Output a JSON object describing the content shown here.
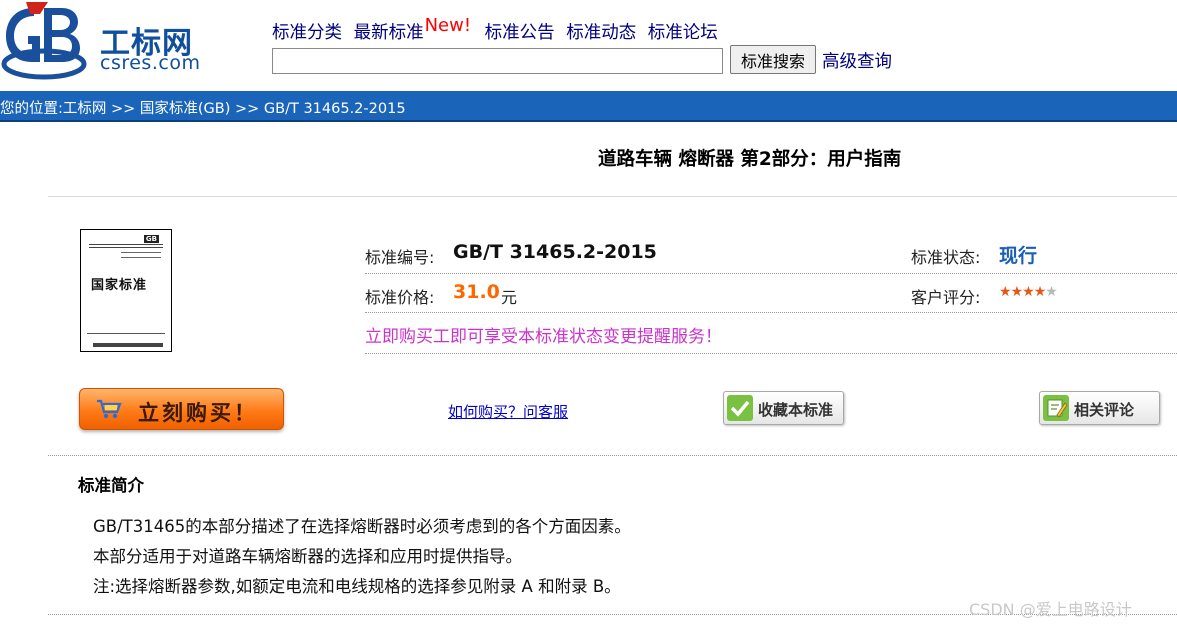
{
  "logo": {
    "mark": "GB",
    "name_cn": "工标网",
    "name_en": "csres.com"
  },
  "topnav": {
    "items": [
      "标准分类",
      "最新标准",
      "标准公告",
      "标准动态",
      "标准论坛"
    ],
    "new_badge": "New!"
  },
  "search": {
    "value": "",
    "button_label": "标准搜索",
    "advanced_label": "高级查询"
  },
  "breadcrumb": "您的位置:工标网 >> 国家标准(GB) >> GB/T 31465.2-2015",
  "title": "道路车辆 熔断器 第2部分：用户指南",
  "cover": {
    "badge": "GB",
    "text": "国家标准"
  },
  "info": {
    "code_label": "标准编号:",
    "code_value": "GB/T 31465.2-2015",
    "status_label": "标准状态:",
    "status_value": "现行",
    "price_label": "标准价格:",
    "price_value": "31.0",
    "price_unit": "元",
    "rating_label": "客户评分:",
    "rating_value": 4.5,
    "promo": "立即购买工即可享受本标准状态变更提醒服务！"
  },
  "actions": {
    "buy_label": "立刻购买！",
    "howto_label": "如何购买？问客服",
    "favorite_label": "收藏本标准",
    "comment_label": "相关评论"
  },
  "intro": {
    "heading": "标准简介",
    "paragraphs": [
      "GB/T31465的本部分描述了在选择熔断器时必须考虑到的各个方面因素。",
      "本部分适用于对道路车辆熔断器的选择和应用时提供指导。",
      "注:选择熔断器参数,如额定电流和电线规格的选择参见附录 A 和附录 B。"
    ]
  },
  "watermark": "CSDN @爱上电路设计",
  "colors": {
    "brand_blue": "#1a65b9",
    "link_navy": "#000080",
    "price_orange": "#ff6600",
    "promo_magenta": "#cc33cc",
    "status_blue": "#1a5fb4",
    "new_red": "#ff0000"
  }
}
